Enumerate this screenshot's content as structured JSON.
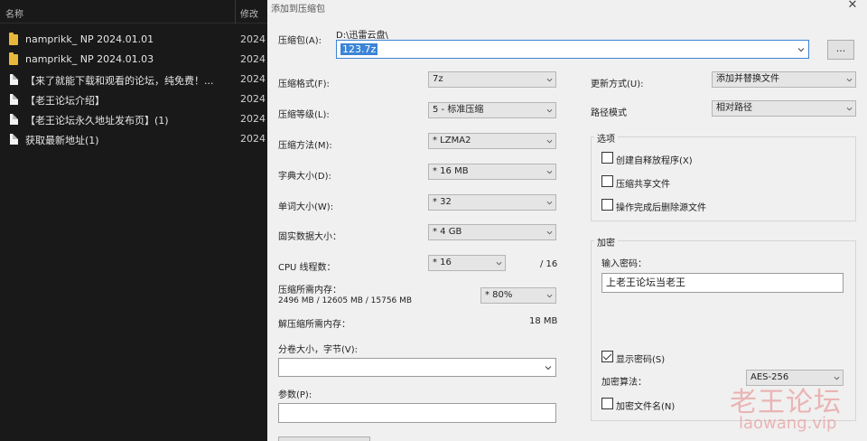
{
  "explorer": {
    "col_name": "名称",
    "col_modified": "修改",
    "rows": [
      {
        "type": "folder",
        "name": "namprikk_ NP 2024.01.01",
        "date": "2024"
      },
      {
        "type": "folder",
        "name": "namprikk_ NP 2024.01.03",
        "date": "2024"
      },
      {
        "type": "file",
        "name": "【来了就能下载和观看的论坛，纯免费！...",
        "date": "2024"
      },
      {
        "type": "file",
        "name": "【老王论坛介绍】",
        "date": "2024"
      },
      {
        "type": "file",
        "name": "【老王论坛永久地址发布页】(1)",
        "date": "2024"
      },
      {
        "type": "file",
        "name": "获取最新地址(1)",
        "date": "2024"
      }
    ]
  },
  "dialog": {
    "title": "添加到压缩包",
    "close": "✕",
    "archive_label": "压缩包(A):",
    "archive_path": "D:\\迅雷云盘\\",
    "archive_name": "123.7z",
    "browse_label": "...",
    "format_label": "压缩格式(F):",
    "format_value": "7z",
    "level_label": "压缩等级(L):",
    "level_value": "5 - 标准压缩",
    "method_label": "压缩方法(M):",
    "method_value": "* LZMA2",
    "dict_label": "字典大小(D):",
    "dict_value": "* 16 MB",
    "word_label": "单词大小(W):",
    "word_value": "* 32",
    "solid_label": "固实数据大小：",
    "solid_value": "* 4 GB",
    "cpu_label": "CPU 线程数：",
    "cpu_value": "* 16",
    "cpu_total": "/ 16",
    "mem_comp_label": "压缩所需内存：",
    "mem_comp_detail": "2496 MB / 12605 MB / 15756 MB",
    "mem_comp_value": "* 80%",
    "mem_decomp_label": "解压缩所需内存：",
    "mem_decomp_value": "18 MB",
    "split_label": "分卷大小，字节(V):",
    "split_value": "",
    "params_label": "参数(P):",
    "params_value": "",
    "update_label": "更新方式(U):",
    "update_value": "添加并替换文件",
    "path_label": "路径模式",
    "path_value": "相对路径",
    "options": {
      "title": "选项",
      "sfx": "创建自释放程序(X)",
      "shared": "压缩共享文件",
      "delete": "操作完成后删除源文件"
    },
    "encryption": {
      "title": "加密",
      "password_label": "输入密码：",
      "password_value": "上老王论坛当老王",
      "show_password": "显示密码(S)",
      "method_label": "加密算法：",
      "method_value": "AES-256",
      "encrypt_names": "加密文件名(N)"
    }
  },
  "watermark": {
    "cn": "老王论坛",
    "en": "laowang.vip"
  }
}
